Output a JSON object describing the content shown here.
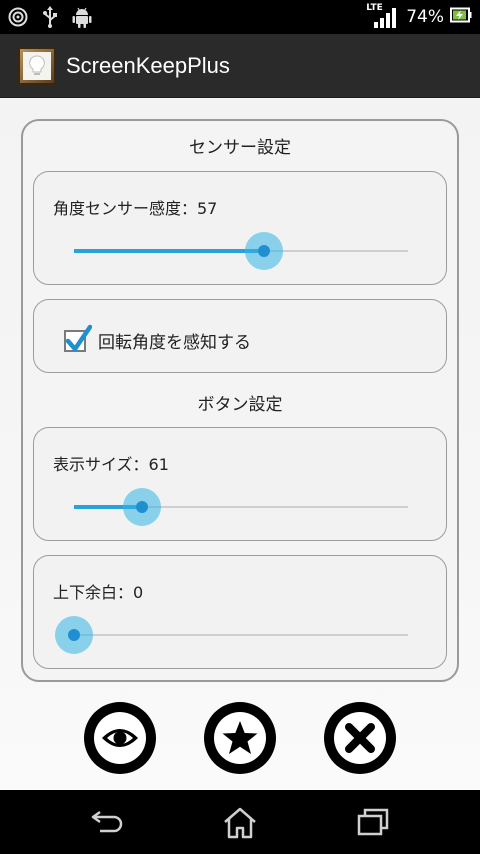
{
  "status_bar": {
    "network_type": "LTE",
    "battery_percent": "74%",
    "icons": [
      "cast-icon",
      "usb-icon",
      "android-debug-icon",
      "signal-icon",
      "battery-charging-icon"
    ]
  },
  "action_bar": {
    "app_title": "ScreenKeepPlus",
    "app_icon": "picture-frame-bulb-icon"
  },
  "sensor_section": {
    "title": "センサー設定",
    "angle_sensitivity": {
      "label": "角度センサー感度：57",
      "value": 57,
      "max": 100
    },
    "detect_rotation": {
      "label": "回転角度を感知する",
      "checked": true
    }
  },
  "button_section": {
    "title": "ボタン設定",
    "display_size": {
      "label": "表示サイズ：61",
      "value": 61,
      "max": 300
    },
    "vertical_margin": {
      "label": "上下余白：0",
      "value": 0,
      "max": 100
    }
  },
  "bottom_buttons": [
    "eye-icon",
    "star-icon",
    "close-icon"
  ],
  "nav_bar": [
    "back-icon",
    "home-icon",
    "recent-apps-icon"
  ],
  "colors": {
    "accent": "#33b5e5",
    "accent_dark": "#1f8fcf",
    "action_bar": "#2a2a2a"
  }
}
